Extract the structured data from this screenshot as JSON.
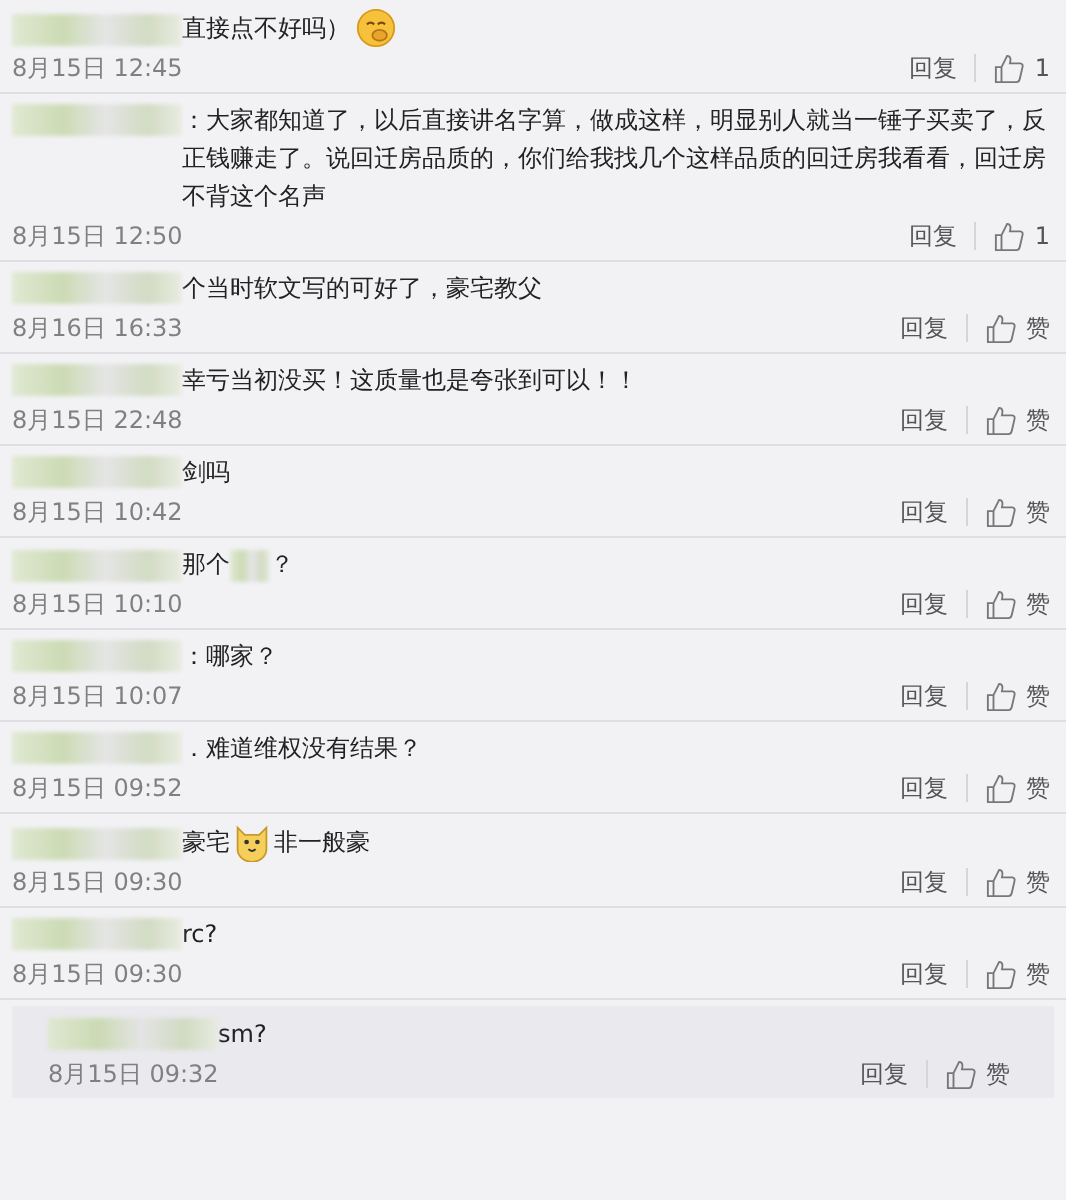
{
  "comments": [
    {
      "segments": [
        {
          "kind": "mosaic"
        },
        {
          "kind": "text",
          "text": "直接点不好吗）"
        },
        {
          "kind": "giggle"
        }
      ],
      "time": "8月15日 12:45",
      "reply": "回复",
      "like": "1",
      "nested": false
    },
    {
      "segments": [
        {
          "kind": "mosaic"
        },
        {
          "kind": "text",
          "text": "：大家都知道了，以后直接讲名字算，做成这样，明显别人就当一锤子买卖了，反正钱赚走了。说回迁房品质的，你们给我找几个这样品质的回迁房我看看，回迁房不背这个名声"
        }
      ],
      "time": "8月15日 12:50",
      "reply": "回复",
      "like": "1",
      "nested": false
    },
    {
      "segments": [
        {
          "kind": "mosaic"
        },
        {
          "kind": "text",
          "text": "个当时软文写的可好了，豪宅教父"
        }
      ],
      "time": "8月16日 16:33",
      "reply": "回复",
      "like": "赞",
      "nested": false
    },
    {
      "segments": [
        {
          "kind": "mosaic"
        },
        {
          "kind": "text",
          "text": "幸亏当初没买！这质量也是夸张到可以！！"
        }
      ],
      "time": "8月15日 22:48",
      "reply": "回复",
      "like": "赞",
      "nested": false
    },
    {
      "segments": [
        {
          "kind": "mosaic"
        },
        {
          "kind": "text",
          "text": "剑吗"
        }
      ],
      "time": "8月15日 10:42",
      "reply": "回复",
      "like": "赞",
      "nested": false
    },
    {
      "segments": [
        {
          "kind": "mosaic"
        },
        {
          "kind": "text",
          "text": "那个"
        },
        {
          "kind": "smudge"
        },
        {
          "kind": "text",
          "text": "？"
        }
      ],
      "time": "8月15日 10:10",
      "reply": "回复",
      "like": "赞",
      "nested": false
    },
    {
      "segments": [
        {
          "kind": "mosaic"
        },
        {
          "kind": "text",
          "text": "：哪家？"
        }
      ],
      "time": "8月15日 10:07",
      "reply": "回复",
      "like": "赞",
      "nested": false
    },
    {
      "segments": [
        {
          "kind": "mosaic"
        },
        {
          "kind": "text",
          "text": "．难道维权没有结果？"
        }
      ],
      "time": "8月15日 09:52",
      "reply": "回复",
      "like": "赞",
      "nested": false
    },
    {
      "segments": [
        {
          "kind": "mosaic"
        },
        {
          "kind": "text",
          "text": "豪宅"
        },
        {
          "kind": "cat"
        },
        {
          "kind": "text",
          "text": "非一般豪"
        }
      ],
      "time": "8月15日 09:30",
      "reply": "回复",
      "like": "赞",
      "nested": false
    },
    {
      "segments": [
        {
          "kind": "mosaic"
        },
        {
          "kind": "text",
          "text": "rc?"
        }
      ],
      "time": "8月15日 09:30",
      "reply": "回复",
      "like": "赞",
      "nested": false
    },
    {
      "segments": [
        {
          "kind": "mosaic"
        },
        {
          "kind": "text",
          "text": "sm?"
        }
      ],
      "time": "8月15日 09:32",
      "reply": "回复",
      "like": "赞",
      "nested": true
    }
  ]
}
